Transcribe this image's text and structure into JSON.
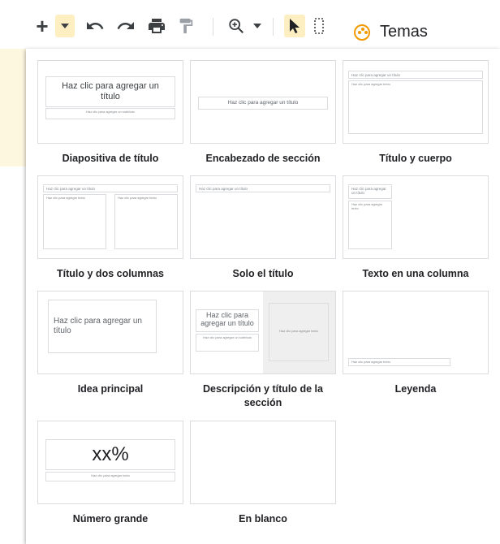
{
  "toolbar": {
    "add_icon": "plus-icon",
    "add_menu_icon": "dropdown-caret-icon",
    "undo_icon": "undo-icon",
    "redo_icon": "redo-icon",
    "print_icon": "print-icon",
    "paint_format_icon": "paint-format-icon",
    "zoom_icon": "zoom-icon",
    "select_icon": "cursor-arrow-icon",
    "textbox_icon": "text-box-icon",
    "themes_label": "Temas",
    "accent_color": "#f29900"
  },
  "layouts": [
    {
      "caption": "Diapositiva de título",
      "title_ph": "Haz clic para agregar un título",
      "subtitle_ph": "Haz clic para agregar un subtítulo"
    },
    {
      "caption": "Encabezado de sección",
      "title_ph": "Haz clic para agregar un título"
    },
    {
      "caption": "Título y cuerpo",
      "title_ph": "Haz clic para agregar un título",
      "body_ph": "Haz clic para agregar texto"
    },
    {
      "caption": "Título y dos columnas",
      "title_ph": "Haz clic para agregar un título",
      "col1_ph": "Haz clic para agregar texto",
      "col2_ph": "Haz clic para agregar texto"
    },
    {
      "caption": "Solo el título",
      "title_ph": "Haz clic para agregar un título"
    },
    {
      "caption": "Texto en una columna",
      "title_ph": "Haz clic para agregar un título",
      "body_ph": "Haz clic para agregar texto"
    },
    {
      "caption": "Idea principal",
      "title_ph": "Haz clic para agregar un título"
    },
    {
      "caption": "Descripción y título de la sección",
      "title_ph": "Haz clic para agregar un título",
      "subtitle_ph": "Haz clic para agregar un subtítulo",
      "side_ph": "Haz clic para agregar texto"
    },
    {
      "caption": "Leyenda",
      "body_ph": "Haz clic para agregar texto"
    },
    {
      "caption": "Número grande",
      "big_ph": "xx%",
      "body_ph": "Haz clic para agregar texto"
    },
    {
      "caption": "En blanco"
    }
  ]
}
